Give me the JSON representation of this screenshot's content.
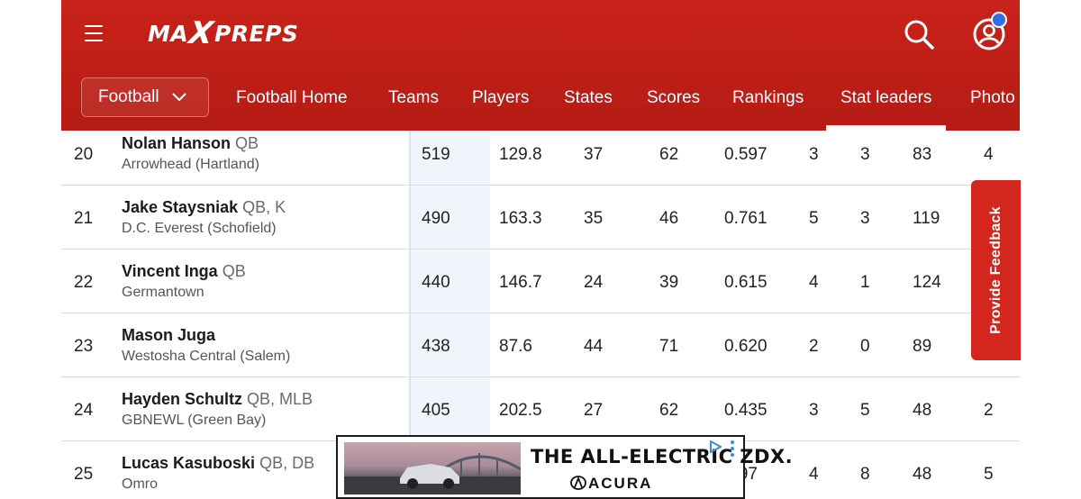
{
  "header": {
    "logo": {
      "left": "MA",
      "x": "X",
      "right": "PREPS"
    },
    "colors": {
      "brand": "#c9221a",
      "highlight_column": "#f0f5fc",
      "feedback": "#d3271e",
      "notification": "#2f6fe0"
    },
    "icons": {
      "menu": "hamburger-icon",
      "search": "search-icon",
      "account": "user-icon"
    }
  },
  "nav": {
    "sport": "Football",
    "tabs": [
      "Football Home",
      "Teams",
      "Players",
      "States",
      "Scores",
      "Rankings",
      "Stat leaders",
      "Photo"
    ],
    "active_tab": "Stat leaders"
  },
  "rows": [
    {
      "rank": "20",
      "name": "Nolan Hanson",
      "pos": "QB",
      "school": "Arrowhead (Hartland)",
      "c": [
        "519",
        "129.8",
        "37",
        "62",
        "0.597",
        "3",
        "3",
        "83",
        "4"
      ]
    },
    {
      "rank": "21",
      "name": "Jake Staysniak",
      "pos": "QB, K",
      "school": "D.C. Everest (Schofield)",
      "c": [
        "490",
        "163.3",
        "35",
        "46",
        "0.761",
        "5",
        "3",
        "119",
        ""
      ]
    },
    {
      "rank": "22",
      "name": "Vincent Inga",
      "pos": "QB",
      "school": "Germantown",
      "c": [
        "440",
        "146.7",
        "24",
        "39",
        "0.615",
        "4",
        "1",
        "124",
        ""
      ]
    },
    {
      "rank": "23",
      "name": "Mason Juga",
      "pos": "",
      "school": "Westosha Central (Salem)",
      "c": [
        "438",
        "87.6",
        "44",
        "71",
        "0.620",
        "2",
        "0",
        "89",
        ""
      ]
    },
    {
      "rank": "24",
      "name": "Hayden Schultz",
      "pos": "QB, MLB",
      "school": "GBNEWL (Green Bay)",
      "c": [
        "405",
        "202.5",
        "27",
        "62",
        "0.435",
        "3",
        "5",
        "48",
        "2"
      ]
    },
    {
      "rank": "25",
      "name": "Lucas Kasuboski",
      "pos": "QB, DB",
      "school": "Omro",
      "c": [
        "",
        "",
        "",
        "",
        ".397",
        "4",
        "8",
        "48",
        "5"
      ]
    }
  ],
  "feedback": {
    "label": "Provide Feedback"
  },
  "ad": {
    "headline": "THE ALL-ELECTRIC ZDX.",
    "brand": "ACURA"
  }
}
